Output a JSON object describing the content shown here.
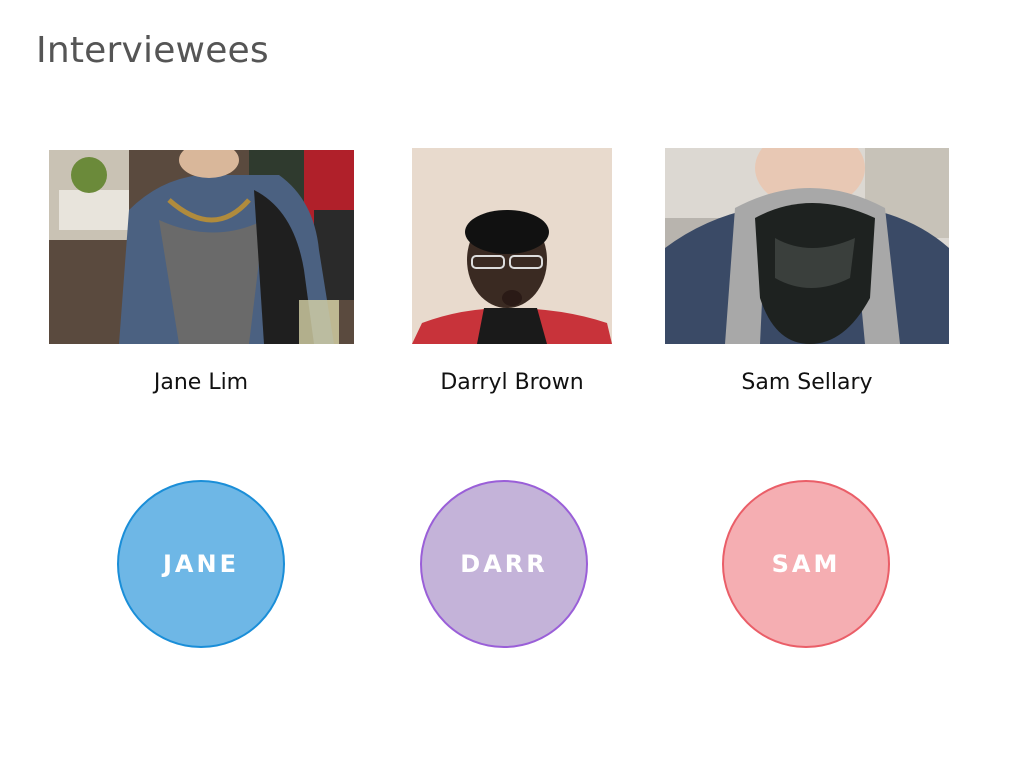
{
  "page": {
    "title": "Interviewees"
  },
  "interviewees": [
    {
      "name": "Jane Lim",
      "badge": "JANE",
      "badge_fill": "#6eb7e6",
      "badge_border": "#1a8ed8"
    },
    {
      "name": "Darryl Brown",
      "badge": "DARR",
      "badge_fill": "#c4b3d9",
      "badge_border": "#9a5fd8"
    },
    {
      "name": "Sam Sellary",
      "badge": "SAM",
      "badge_fill": "#f5aeb2",
      "badge_border": "#ea5e68"
    }
  ]
}
